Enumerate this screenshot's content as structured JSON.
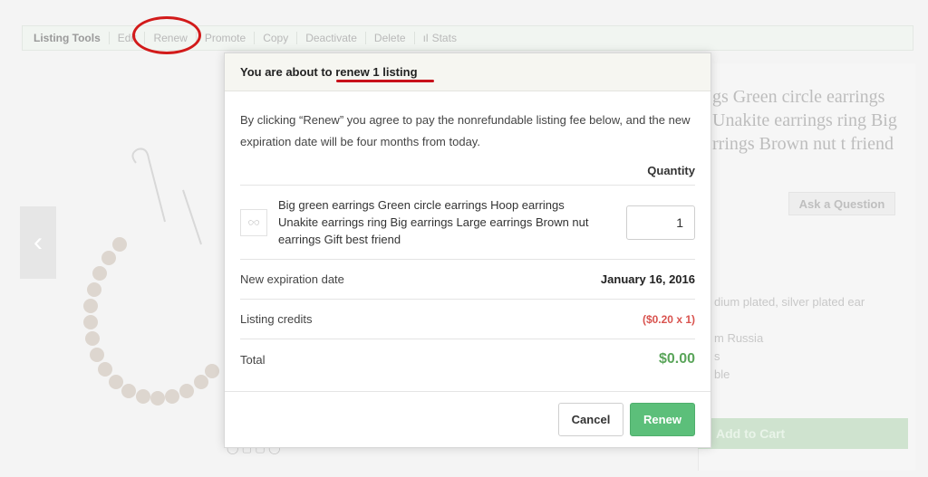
{
  "toolbar": {
    "label": "Listing Tools",
    "items": [
      "Edit",
      "Renew",
      "Promote",
      "Copy",
      "Deactivate",
      "Delete",
      "Stats"
    ]
  },
  "background": {
    "title": "gs Green circle earrings Unakite earrings ring Big rrings Brown nut t friend",
    "ask_question": "Ask a Question",
    "details": [
      "dium plated, silver plated ear",
      "",
      "m Russia",
      "s",
      "ble"
    ],
    "add_to_cart": "Add to Cart"
  },
  "modal": {
    "header": "You are about to renew 1 listing",
    "intro": "By clicking “Renew” you agree to pay the nonrefundable listing fee below, and the new expiration date will be four months from today.",
    "quantity_header": "Quantity",
    "item": {
      "title": "Big green earrings Green circle earrings Hoop earrings Unakite earrings ring Big earrings Large earrings Brown nut earrings Gift best friend",
      "quantity": "1"
    },
    "expiration": {
      "label": "New expiration date",
      "value": "January 16, 2016"
    },
    "credits": {
      "label": "Listing credits",
      "value": "($0.20 x 1)"
    },
    "total": {
      "label": "Total",
      "value": "$0.00"
    },
    "cancel_label": "Cancel",
    "renew_label": "Renew"
  },
  "colors": {
    "annotation_red": "#d21a1a",
    "renew_green": "#5cbf7a",
    "credits_red": "#d9534f",
    "total_green": "#5aa55a"
  }
}
